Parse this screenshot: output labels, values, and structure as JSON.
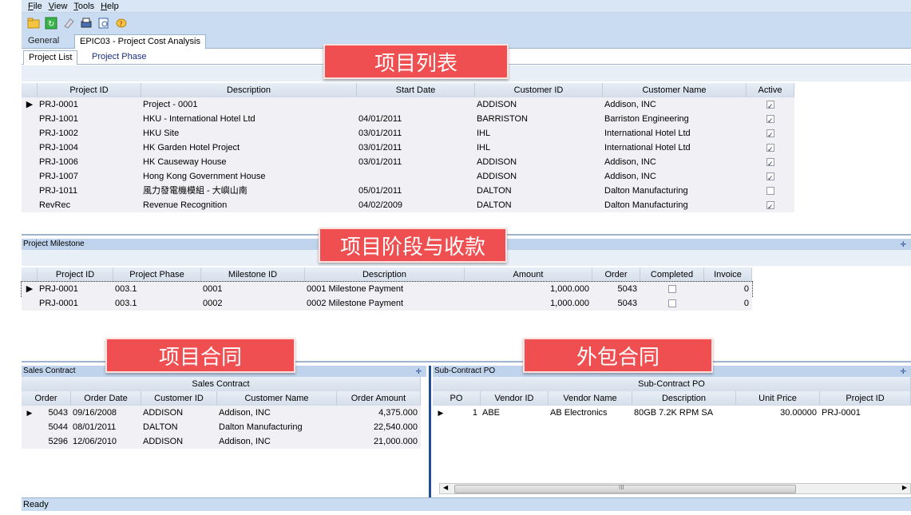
{
  "menu": {
    "file": "File",
    "view": "View",
    "tools": "Tools",
    "help": "Help"
  },
  "tabs": {
    "general": "General",
    "epic": "EPIC03 - Project Cost Analysis"
  },
  "subtabs": {
    "list": "Project List",
    "phase": "Project Phase"
  },
  "overlays": {
    "list": "项目列表",
    "milestone": "项目阶段与收款",
    "sales": "项目合同",
    "sub": "外包合同"
  },
  "project_list": {
    "columns": [
      "Project ID",
      "Description",
      "Start Date",
      "Customer ID",
      "Customer Name",
      "Active"
    ],
    "rows": [
      {
        "id": "PRJ-0001",
        "desc": "Project - 0001",
        "start": "",
        "cust": "ADDISON",
        "name": "Addison, INC",
        "active": true
      },
      {
        "id": "PRJ-1001",
        "desc": "HKU - International Hotel Ltd",
        "start": "04/01/2011",
        "cust": "BARRISTON",
        "name": "Barriston Engineering",
        "active": true
      },
      {
        "id": "PRJ-1002",
        "desc": "HKU Site",
        "start": "03/01/2011",
        "cust": "IHL",
        "name": "International Hotel Ltd",
        "active": true
      },
      {
        "id": "PRJ-1004",
        "desc": "HK Garden Hotel Project",
        "start": "03/01/2011",
        "cust": "IHL",
        "name": "International Hotel Ltd",
        "active": true
      },
      {
        "id": "PRJ-1006",
        "desc": "HK Causeway House",
        "start": "03/01/2011",
        "cust": "ADDISON",
        "name": "Addison, INC",
        "active": true
      },
      {
        "id": "PRJ-1007",
        "desc": "Hong Kong Government House",
        "start": "",
        "cust": "ADDISON",
        "name": "Addison, INC",
        "active": true
      },
      {
        "id": "PRJ-1011",
        "desc": "風力發電機模組 - 大嶼山南",
        "start": "05/01/2011",
        "cust": "DALTON",
        "name": "Dalton Manufacturing",
        "active": false
      },
      {
        "id": "RevRec",
        "desc": "Revenue Recognition",
        "start": "04/02/2009",
        "cust": "DALTON",
        "name": "Dalton Manufacturing",
        "active": true
      }
    ]
  },
  "milestone": {
    "title": "Project Milestone",
    "columns": [
      "Project ID",
      "Project Phase",
      "Milestone ID",
      "Description",
      "Amount",
      "Order",
      "Completed",
      "Invoice"
    ],
    "rows": [
      {
        "id": "PRJ-0001",
        "phase": "003.1",
        "mid": "0001",
        "desc": "0001 Milestone Payment",
        "amount": "1,000.000",
        "order": "5043",
        "completed": false,
        "invoice": "0"
      },
      {
        "id": "PRJ-0001",
        "phase": "003.1",
        "mid": "0002",
        "desc": "0002 Milestone Payment",
        "amount": "1,000.000",
        "order": "5043",
        "completed": false,
        "invoice": "0"
      }
    ]
  },
  "sales": {
    "title": "Sales Contract",
    "group": "Sales Contract",
    "columns": [
      "Order",
      "Order Date",
      "Customer ID",
      "Customer Name",
      "Order Amount"
    ],
    "rows": [
      {
        "order": "5043",
        "date": "09/16/2008",
        "cust": "ADDISON",
        "name": "Addison, INC",
        "amount": "4,375.000"
      },
      {
        "order": "5044",
        "date": "08/01/2011",
        "cust": "DALTON",
        "name": "Dalton Manufacturing",
        "amount": "22,540.000"
      },
      {
        "order": "5296",
        "date": "12/06/2010",
        "cust": "ADDISON",
        "name": "Addison, INC",
        "amount": "21,000.000"
      }
    ]
  },
  "subpo": {
    "title": "Sub-Contract PO",
    "group": "Sub-Contract PO",
    "columns": [
      "PO",
      "Vendor ID",
      "Vendor Name",
      "Description",
      "Unit Price",
      "Project ID"
    ],
    "rows": [
      {
        "po": "1",
        "vid": "ABE",
        "vname": "AB Electronics",
        "desc": "80GB 7.2K RPM SA",
        "price": "30.00000",
        "pid": "PRJ-0001"
      }
    ],
    "scroll_mid": "III"
  },
  "status": "Ready",
  "colors": {
    "overlay": "#ef4f51",
    "header_band": "#c9dcf2"
  }
}
